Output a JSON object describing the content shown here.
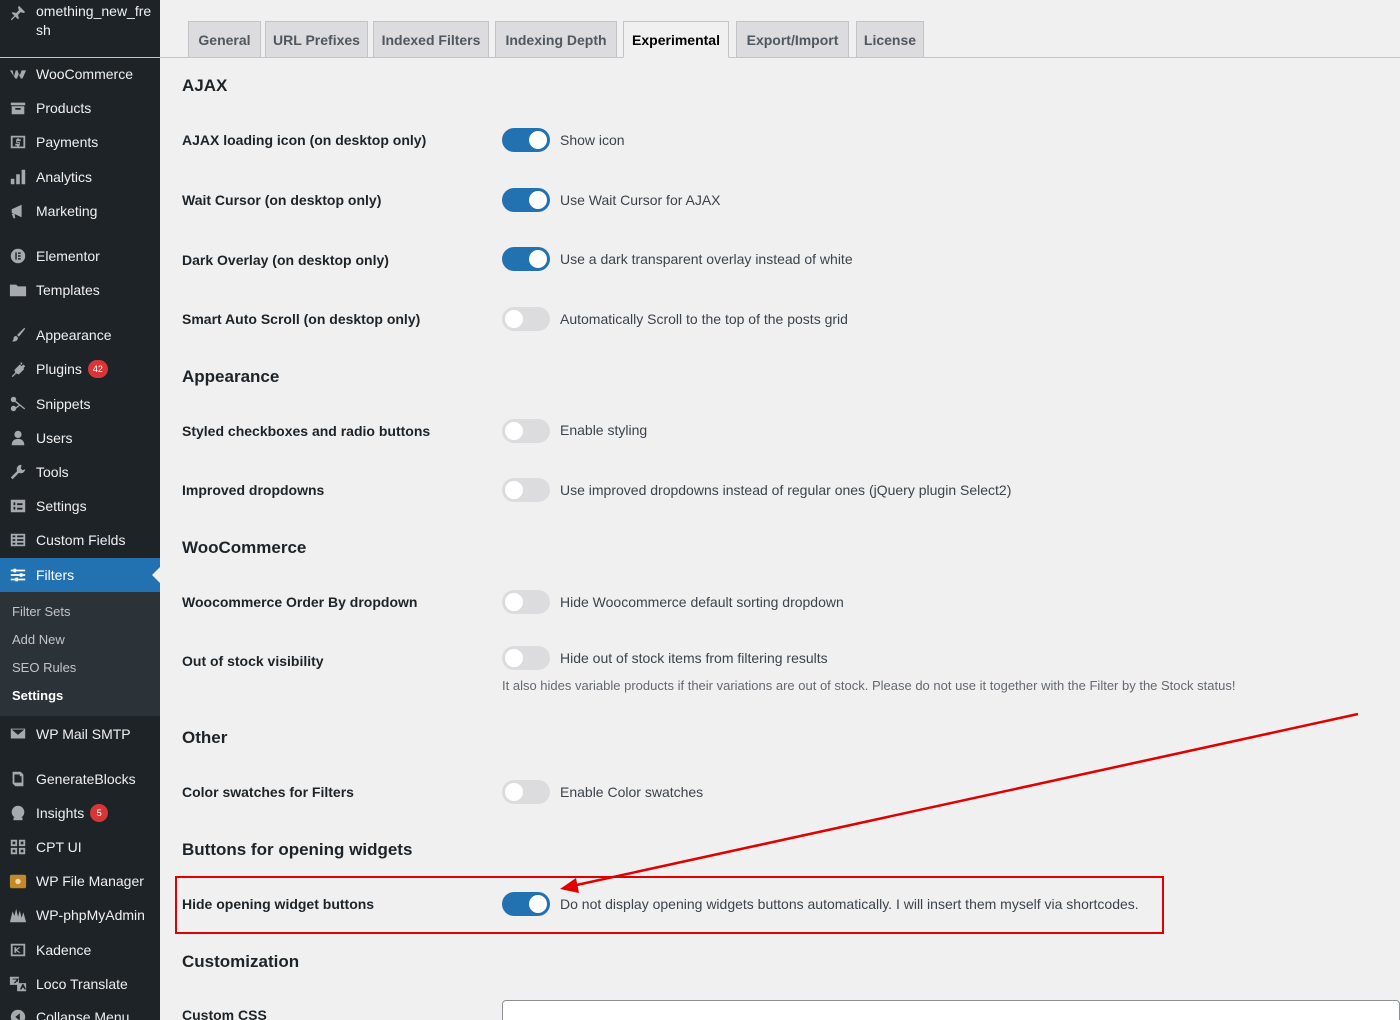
{
  "sidebar": {
    "site_title": "omething_new_fresh",
    "items": [
      {
        "label": "WooCommerce",
        "icon": "woocommerce-icon"
      },
      {
        "label": "Products",
        "icon": "products-icon"
      },
      {
        "label": "Payments",
        "icon": "payments-icon"
      },
      {
        "label": "Analytics",
        "icon": "analytics-icon"
      },
      {
        "label": "Marketing",
        "icon": "marketing-icon"
      },
      {
        "label": "Elementor",
        "icon": "elementor-icon"
      },
      {
        "label": "Templates",
        "icon": "folder-icon"
      },
      {
        "label": "Appearance",
        "icon": "paintbrush-icon"
      },
      {
        "label": "Plugins",
        "icon": "plug-icon",
        "badge": "42"
      },
      {
        "label": "Snippets",
        "icon": "scissors-icon"
      },
      {
        "label": "Users",
        "icon": "users-icon"
      },
      {
        "label": "Tools",
        "icon": "wrench-icon"
      },
      {
        "label": "Settings",
        "icon": "settings-icon"
      },
      {
        "label": "Custom Fields",
        "icon": "table-icon"
      },
      {
        "label": "Filters",
        "icon": "filters-icon"
      },
      {
        "label": "WP Mail SMTP",
        "icon": "mail-icon"
      },
      {
        "label": "GenerateBlocks",
        "icon": "generateblocks-icon"
      },
      {
        "label": "Insights",
        "icon": "insights-icon",
        "badge": "5"
      },
      {
        "label": "CPT UI",
        "icon": "grid-icon"
      },
      {
        "label": "WP File Manager",
        "icon": "file-manager-icon"
      },
      {
        "label": "WP-phpMyAdmin",
        "icon": "phpmyadmin-icon"
      },
      {
        "label": "Kadence",
        "icon": "kadence-icon"
      },
      {
        "label": "Loco Translate",
        "icon": "translate-icon"
      },
      {
        "label": "Collapse Menu",
        "icon": "collapse-icon"
      }
    ],
    "submenu": [
      "Filter Sets",
      "Add New",
      "SEO Rules",
      "Settings"
    ]
  },
  "tabs": [
    "General",
    "URL Prefixes",
    "Indexed Filters",
    "Indexing Depth",
    "Experimental",
    "Export/Import",
    "License"
  ],
  "active_tab": "Experimental",
  "sections": {
    "ajax": {
      "heading": "AJAX",
      "rows": [
        {
          "label": "AJAX loading icon (on desktop only)",
          "text": "Show icon",
          "on": true
        },
        {
          "label": "Wait Cursor (on desktop only)",
          "text": "Use Wait Cursor for AJAX",
          "on": true
        },
        {
          "label": "Dark Overlay (on desktop only)",
          "text": "Use a dark transparent overlay instead of white",
          "on": true
        },
        {
          "label": "Smart Auto Scroll (on desktop only)",
          "text": "Automatically Scroll to the top of the posts grid",
          "on": false
        }
      ]
    },
    "appearance": {
      "heading": "Appearance",
      "rows": [
        {
          "label": "Styled checkboxes and radio buttons",
          "text": "Enable styling",
          "on": false
        },
        {
          "label": "Improved dropdowns",
          "text": "Use improved dropdowns instead of regular ones (jQuery plugin Select2)",
          "on": false
        }
      ]
    },
    "woocommerce": {
      "heading": "WooCommerce",
      "rows": [
        {
          "label": "Woocommerce Order By dropdown",
          "text": "Hide Woocommerce default sorting dropdown",
          "on": false
        },
        {
          "label": "Out of stock visibility",
          "text": "Hide out of stock items from filtering results",
          "on": false,
          "description": "It also hides variable products if their variations are out of stock. Please do not use it together with the Filter by the Stock status!"
        }
      ]
    },
    "other": {
      "heading": "Other",
      "rows": [
        {
          "label": "Color swatches for Filters",
          "text": "Enable Color swatches",
          "on": false
        }
      ]
    },
    "buttons": {
      "heading": "Buttons for opening widgets",
      "rows": [
        {
          "label": "Hide opening widget buttons",
          "text": "Do not display opening widgets buttons automatically. I will insert them myself via shortcodes.",
          "on": true
        }
      ]
    },
    "customization": {
      "heading": "Customization",
      "rows": [
        {
          "label": "Custom CSS"
        }
      ]
    }
  },
  "colors": {
    "sidebar_bg": "#1d2327",
    "accent": "#2271b1",
    "highlight": "#e10000"
  }
}
